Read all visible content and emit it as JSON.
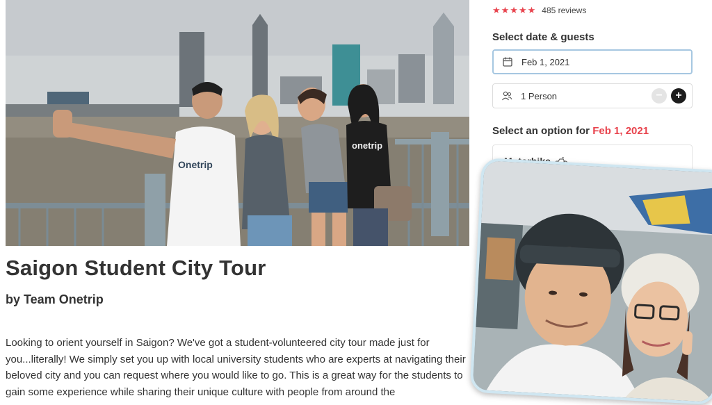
{
  "listing": {
    "title": "Saigon Student City Tour",
    "byline": "by Team Onetrip",
    "description": "Looking to orient yourself in Saigon? We've got a student-volunteered city tour made just for you...literally! We simply set you up with local university students who are experts at navigating their beloved city and you can request where you would like to go. This is a great way for the students to gain some experience while sharing their unique culture with people from around the",
    "hero_shirt_text_1": "Onetrip",
    "hero_shirt_text_2": "onetrip"
  },
  "booking": {
    "stars": "★★★★★",
    "reviews": "485 reviews",
    "select_label": "Select date & guests",
    "date_value": "Feb 1, 2021",
    "date_icon": "calendar-icon",
    "guests_value": "1 Person",
    "guests_icon": "people-icon",
    "minus_label": "−",
    "plus_label": "+",
    "option_label_prefix": "Select an option for ",
    "option_label_date": "Feb 1, 2021",
    "option_1": "Motorbike"
  },
  "colors": {
    "accent": "#e8434d",
    "field_focus": "#a6c7e1",
    "photo_border": "#cfe6f1"
  }
}
